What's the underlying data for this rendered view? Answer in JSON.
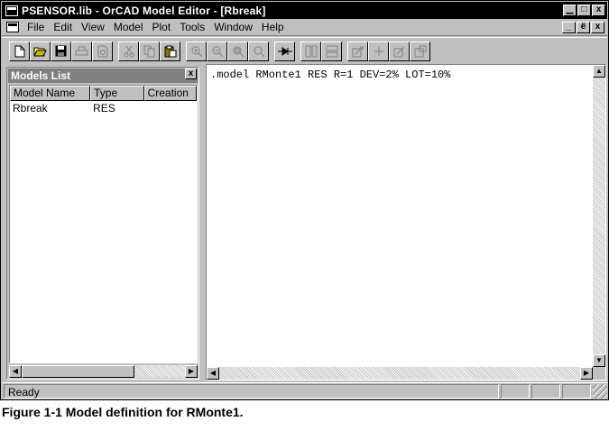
{
  "window": {
    "title": "PSENSOR.lib - OrCAD Model Editor - [Rbreak]",
    "min_glyph": "▁",
    "max_glyph": "□",
    "close_glyph": "x",
    "mdi_min_glyph": "_",
    "mdi_restore_glyph": "ё",
    "mdi_close_glyph": "x"
  },
  "menu": {
    "items": [
      "File",
      "Edit",
      "View",
      "Model",
      "Plot",
      "Tools",
      "Window",
      "Help"
    ]
  },
  "models_list": {
    "title": "Models List",
    "close_glyph": "x",
    "columns": [
      "Model Name",
      "Type",
      "Creation"
    ],
    "rows": [
      {
        "name": "Rbreak",
        "type": "RES",
        "creation": ""
      }
    ]
  },
  "editor": {
    "text": ".model RMonte1 RES R=1 DEV=2% LOT=10%"
  },
  "statusbar": {
    "text": "Ready"
  },
  "caption": {
    "text": "Figure 1-1  Model definition for RMonte1."
  },
  "toolbar": {
    "icons": [
      "new-file-icon",
      "open-folder-icon",
      "save-icon",
      "print-icon",
      "print-preview-icon",
      "cut-icon",
      "copy-icon",
      "paste-icon",
      "zoom-in-icon",
      "zoom-out-icon",
      "zoom-area-icon",
      "zoom-fit-icon",
      "model-part-icon",
      "tile-vertical-icon",
      "tile-horizontal-icon",
      "extract-model-icon",
      "add-curve-icon",
      "add-data-icon",
      "new-model-icon"
    ]
  }
}
